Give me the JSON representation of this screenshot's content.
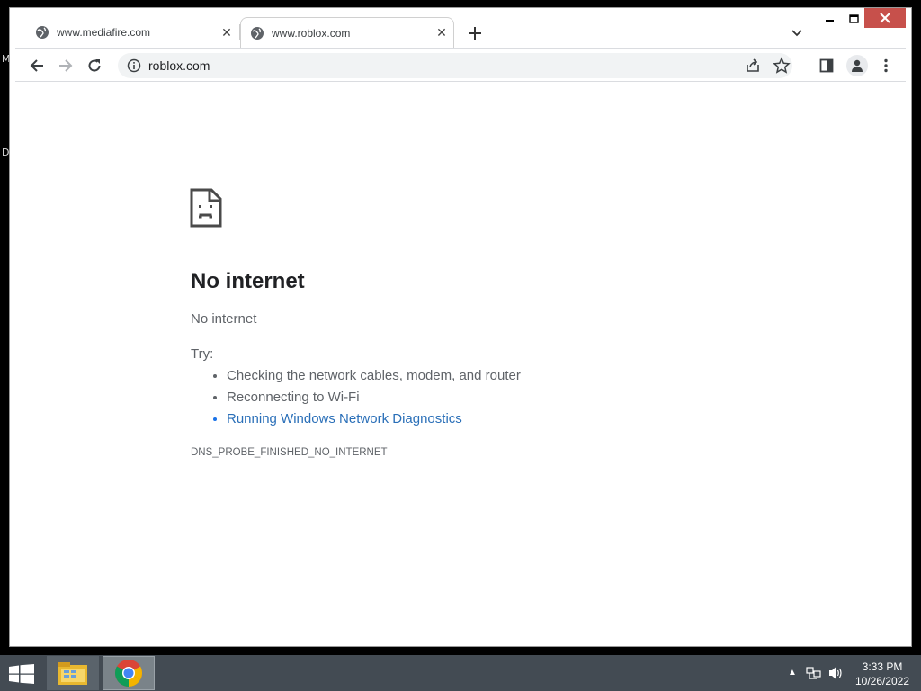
{
  "desktop": {
    "letters": [
      "M",
      "D"
    ]
  },
  "tabs": [
    {
      "title": "www.mediafire.com",
      "active": false
    },
    {
      "title": "www.roblox.com",
      "active": true
    }
  ],
  "omnibox": {
    "url": "roblox.com"
  },
  "error": {
    "title": "No internet",
    "subtitle": "No internet",
    "try_label": "Try:",
    "suggestions": [
      "Checking the network cables, modem, and router",
      "Reconnecting to Wi-Fi",
      "Running Windows Network Diagnostics"
    ],
    "code": "DNS_PROBE_FINISHED_NO_INTERNET"
  },
  "taskbar": {
    "time": "3:33 PM",
    "date": "10/26/2022"
  },
  "colors": {
    "link": "#2a6fb8",
    "close_button": "#c7504b",
    "taskbar": "#434b53"
  }
}
